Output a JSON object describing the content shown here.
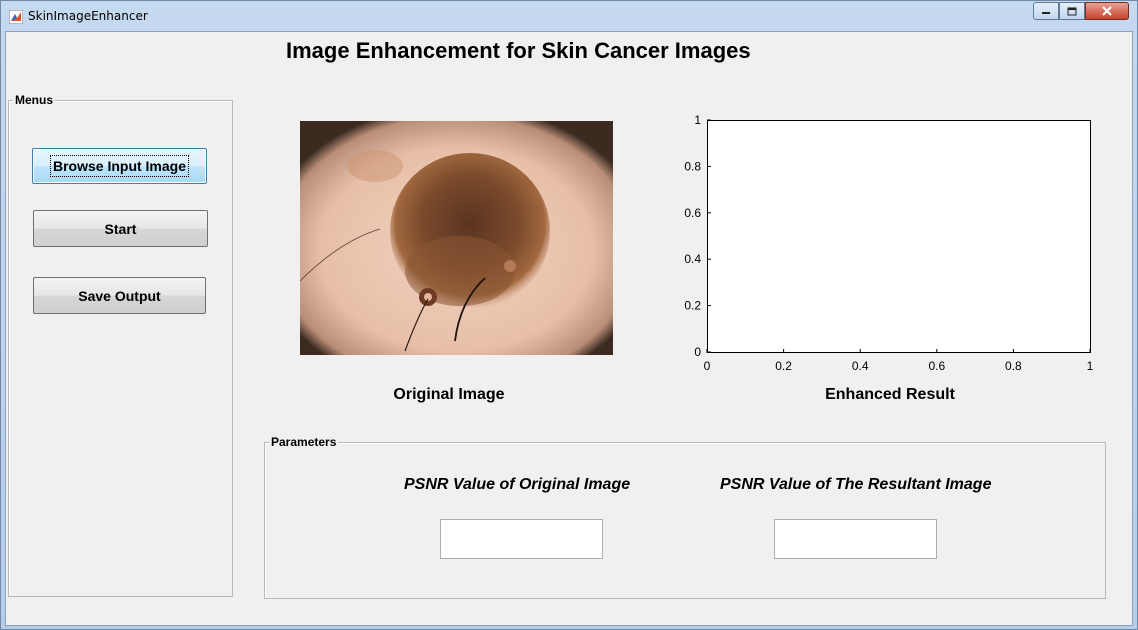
{
  "window": {
    "title": "SkinImageEnhancer",
    "controls": {
      "minimize_icon": "minimize-icon",
      "maximize_icon": "maximize-icon",
      "close_icon": "close-icon"
    }
  },
  "heading": "Image Enhancement for Skin Cancer Images",
  "menus": {
    "title": "Menus",
    "browse_label": "Browse Input Image",
    "start_label": "Start",
    "save_label": "Save Output"
  },
  "original": {
    "caption": "Original Image"
  },
  "enhanced": {
    "caption": "Enhanced Result",
    "chart_data": {
      "type": "line",
      "series": [],
      "xlim": [
        0,
        1
      ],
      "ylim": [
        0,
        1
      ],
      "xticks": [
        "0",
        "0.2",
        "0.4",
        "0.6",
        "0.8",
        "1"
      ],
      "yticks": [
        "0",
        "0.2",
        "0.4",
        "0.6",
        "0.8",
        "1"
      ],
      "grid": false
    }
  },
  "parameters": {
    "title": "Parameters",
    "psnr_original_label": "PSNR Value of Original Image",
    "psnr_result_label": "PSNR Value of The Resultant Image",
    "psnr_original_value": "",
    "psnr_result_value": ""
  },
  "colors": {
    "accent": "#3c7fb1",
    "close": "#c6432f"
  }
}
